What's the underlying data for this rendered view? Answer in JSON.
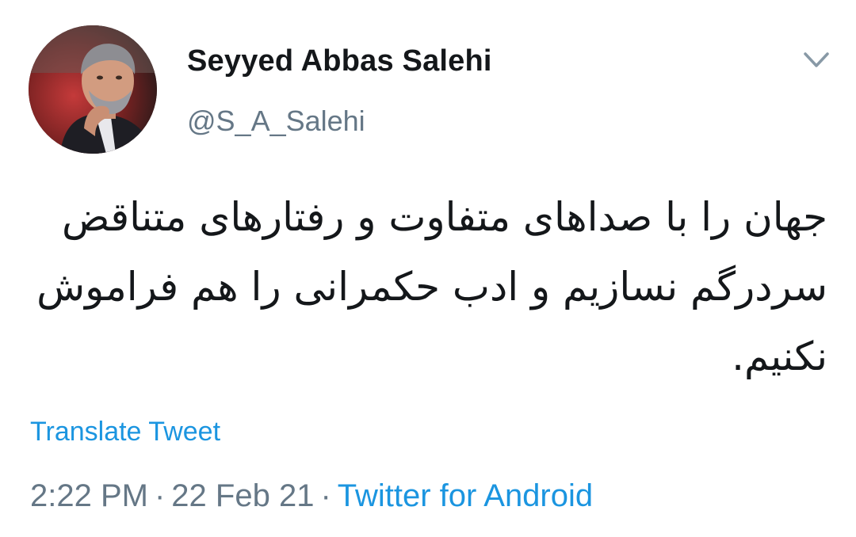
{
  "author": {
    "display_name": "Seyyed Abbas Salehi",
    "handle": "@S_A_Salehi",
    "avatar_icon": "user-avatar-photo"
  },
  "tweet": {
    "text": "جهان را با صداهای متفاوت و رفتارهای متناقض سردرگم نسازیم و ادب حکمرانی را هم فراموش نکنیم.",
    "translate_label": "Translate Tweet",
    "time": "2:22 PM",
    "date": "22 Feb 21",
    "separator": "·",
    "source": "Twitter for Android"
  },
  "icons": {
    "menu": "chevron-down-icon"
  },
  "colors": {
    "link": "#1b95e0",
    "secondary": "#657786",
    "primary": "#14171a"
  }
}
